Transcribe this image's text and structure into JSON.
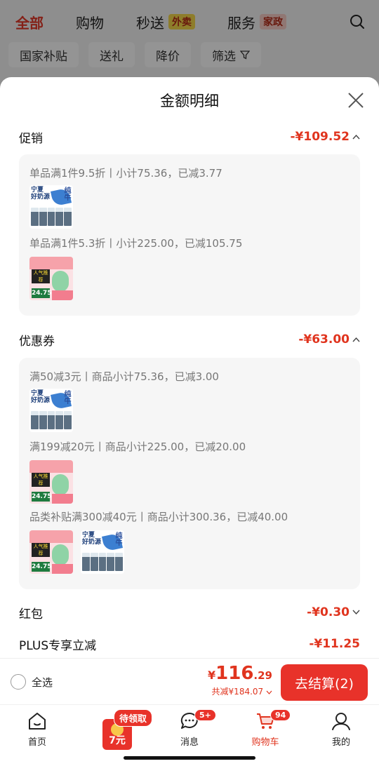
{
  "top_nav": {
    "tabs": [
      {
        "label": "全部"
      },
      {
        "label": "购物"
      },
      {
        "label": "秒送",
        "tag": "外卖"
      },
      {
        "label": "服务",
        "tag": "家政"
      }
    ]
  },
  "filters": [
    "国家补贴",
    "送礼",
    "降价",
    "筛选"
  ],
  "sheet": {
    "title": "金额明细",
    "promotion": {
      "name": "促销",
      "amount": "-¥109.52",
      "rules": [
        "单品满1件9.5折丨小计75.36，已减3.77",
        "单品满1件5.3折丨小计225.00，已减105.75"
      ]
    },
    "coupon": {
      "name": "优惠券",
      "amount": "-¥63.00",
      "rules": [
        "满50减3元丨商品小计75.36，已减3.00",
        "满199减20元丨商品小计225.00，已减20.00",
        "品类补贴满300减40元丨商品小计300.36，已减40.00"
      ]
    },
    "red_packet": {
      "name": "红包",
      "amount": "-¥0.30"
    },
    "plus": {
      "name": "PLUS专享立减",
      "amount": "-¥11.25"
    }
  },
  "product_images": {
    "milk_label_1": "宁夏",
    "milk_label_2": "好奶源",
    "milk_side": "纯牛",
    "drink_label": "人气推荐",
    "drink_price": "24.75"
  },
  "checkout": {
    "select_all": "全选",
    "currency": "¥",
    "total_int": "116",
    "total_dec": ".29",
    "saved": "共减¥184.07",
    "button": "去结算(2)"
  },
  "tabbar": {
    "items": [
      {
        "label": "首页"
      },
      {
        "label": "消息",
        "badge": "5+"
      },
      {
        "label": "购物车",
        "badge": "94"
      },
      {
        "label": "我的"
      }
    ],
    "promo": {
      "badge": "待领取",
      "amount": "7元"
    }
  },
  "colors": {
    "accent": "#e8322a",
    "price": "#e0341e"
  }
}
